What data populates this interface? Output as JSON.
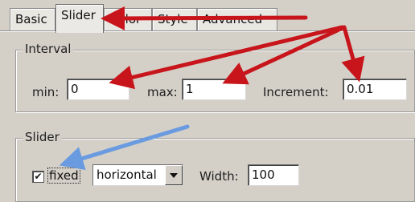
{
  "tabs": [
    {
      "label": "Basic",
      "active": false
    },
    {
      "label": "Slider",
      "active": true
    },
    {
      "label": "Color",
      "active": false
    },
    {
      "label": "Style",
      "active": false
    },
    {
      "label": "Advanced",
      "active": false
    }
  ],
  "interval": {
    "title": "Interval",
    "min_label": "min:",
    "min_value": "0",
    "max_label": "max:",
    "max_value": "1",
    "increment_label": "Increment:",
    "increment_value": "0.01"
  },
  "slider": {
    "title": "Slider",
    "fixed_checked": true,
    "fixed_label": "fixed",
    "orientation_value": "horizontal",
    "width_label": "Width:",
    "width_value": "100"
  },
  "annotations": {
    "red_arrow_color": "#c8151b",
    "blue_arrow_color": "#6a9be0"
  }
}
